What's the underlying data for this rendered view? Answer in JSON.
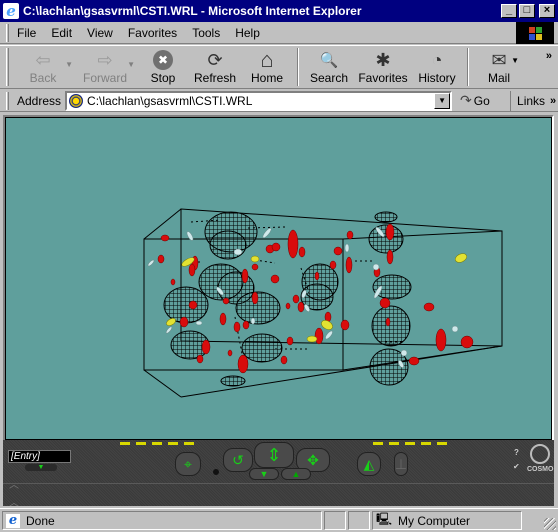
{
  "window": {
    "title": "C:\\lachlan\\gsasvrml\\CSTI.WRL - Microsoft Internet Explorer",
    "controls": {
      "minimize": "_",
      "maximize": "□",
      "close": "×"
    }
  },
  "menu": {
    "items": [
      {
        "label": "File",
        "accel": "F"
      },
      {
        "label": "Edit",
        "accel": "E"
      },
      {
        "label": "View",
        "accel": "V"
      },
      {
        "label": "Favorites",
        "accel": "a"
      },
      {
        "label": "Tools",
        "accel": "T"
      },
      {
        "label": "Help",
        "accel": "H"
      }
    ]
  },
  "toolbar": {
    "buttons": [
      {
        "label": "Back",
        "icon": "back-arrow-icon",
        "glyph": "⇦",
        "disabled": true
      },
      {
        "label": "Forward",
        "icon": "forward-arrow-icon",
        "glyph": "⇨",
        "disabled": true
      },
      {
        "label": "Stop",
        "icon": "stop-icon",
        "glyph": "✖",
        "disabled": false
      },
      {
        "label": "Refresh",
        "icon": "refresh-icon",
        "glyph": "⟳",
        "disabled": false
      },
      {
        "label": "Home",
        "icon": "home-icon",
        "glyph": "⌂",
        "disabled": false
      },
      {
        "label": "Search",
        "icon": "search-icon",
        "glyph": "🔍",
        "disabled": false
      },
      {
        "label": "Favorites",
        "icon": "favorites-icon",
        "glyph": "✱",
        "disabled": false
      },
      {
        "label": "History",
        "icon": "history-icon",
        "glyph": "◔",
        "disabled": false
      },
      {
        "label": "Mail",
        "icon": "mail-icon",
        "glyph": "✉",
        "disabled": false
      }
    ],
    "more": "»"
  },
  "address": {
    "label": "Address",
    "value": "C:\\lachlan\\gsasvrml\\CSTI.WRL",
    "go_label": "Go",
    "links_label": "Links",
    "links_more": "»"
  },
  "viewer": {
    "background": "#5f9f9c",
    "viewpoint_entry": "[Entry]",
    "logo_text": "COSMO",
    "help_glyph": "?",
    "check_glyph": "✔"
  },
  "status": {
    "text": "Done",
    "zone": "My Computer"
  }
}
